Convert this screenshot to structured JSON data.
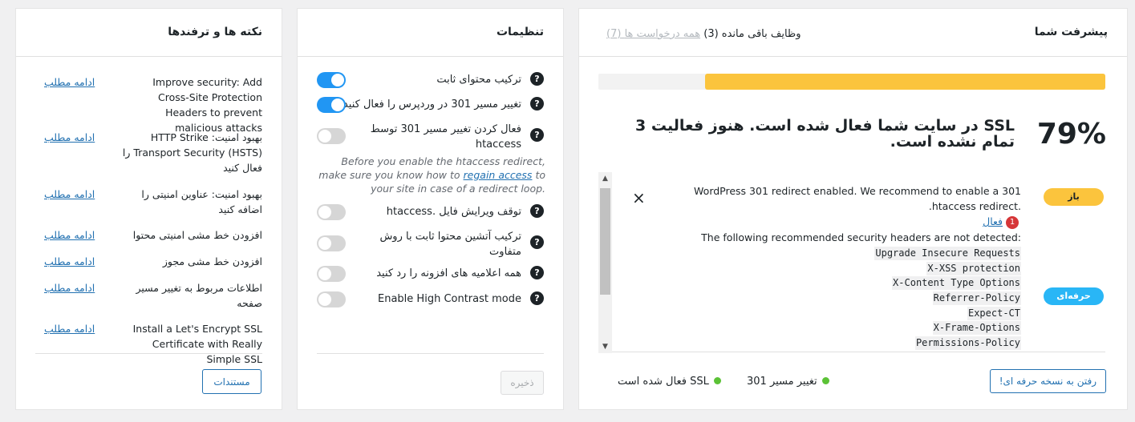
{
  "progress": {
    "title": "پیشرفت شما",
    "tab_remaining": "وظایف باقی مانده (3)",
    "tab_all": "همه درخواست ها",
    "tab_all_count": "(7)",
    "progress_fraction": 0.79,
    "percent": "79%",
    "score_text": "SSL در سایت شما فعال شده است. هنوز فعالیت 3 تمام نشده است.",
    "tasks": [
      {
        "badge": "باز",
        "text": "WordPress 301 redirect enabled. We recommend to enable a 301 .htaccess redirect.",
        "link": "فعال",
        "count": "1",
        "close": "×"
      },
      {
        "badge": "حرفه‌ای",
        "intro": "The following recommended security headers are not detected:",
        "headers": [
          "Upgrade Insecure Requests",
          "X-XSS protection",
          "X-Content Type Options",
          "Referrer-Policy",
          "Expect-CT",
          "X-Frame-Options",
          "Permissions-Policy"
        ]
      }
    ],
    "status": [
      "تغییر مسیر 301",
      "SSL فعال شده است"
    ],
    "go_pro": "رفتن به نسخه حرفه ای!"
  },
  "settings": {
    "title": "تنظیمات",
    "items": [
      {
        "label": "ترکیب محتوای ثابت",
        "on": true
      },
      {
        "label": "تغییر مسیر 301 در وردپرس را فعال کنید",
        "on": true
      },
      {
        "label": "فعال کردن تغییر مسیر 301 توسط htaccess",
        "on": false
      },
      {
        "label": "توقف ویرایش فایل .htaccess",
        "on": false
      },
      {
        "label": "ترکیب آتشین محتوا ثابت با روش متفاوت",
        "on": false
      },
      {
        "label": "همه اعلامیه های افزونه را رد کنید",
        "on": false
      },
      {
        "label": "Enable High Contrast mode",
        "on": false
      }
    ],
    "note_pre": "Before you enable the htaccess redirect, make sure you know how to",
    "note_link": "regain access",
    "note_post": "to your site in case of a redirect loop.",
    "save": "ذخیره"
  },
  "tips": {
    "title": "نکته ها و ترفندها",
    "read_more": "ادامه مطلب",
    "items": [
      "Improve security: Add Cross-Site Protection Headers to prevent malicious attacks",
      "بهبود امنیت: HTTP Strike Transport Security (HSTS) را فعال کنید",
      "بهبود امنیت: عناوین امنیتی را اضافه کنید",
      "افزودن خط مشی امنیتی محتوا",
      "افزودن خط مشی مجوز",
      "اطلاعات مربوط به تغییر مسیر صفحه",
      "Install a Let's Encrypt SSL Certificate with Really Simple SSL"
    ],
    "docs": "مستندات"
  }
}
